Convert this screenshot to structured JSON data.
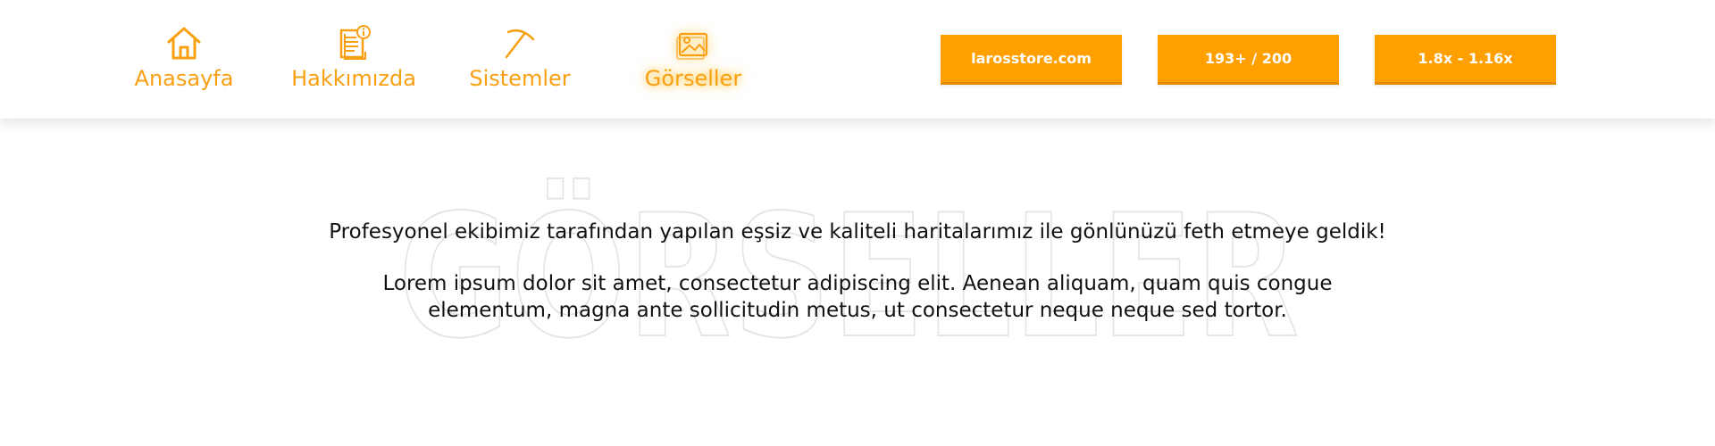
{
  "nav": {
    "items": [
      {
        "label": "Anasayfa",
        "icon": "home-icon"
      },
      {
        "label": "Hakkımızda",
        "icon": "document-info-icon"
      },
      {
        "label": "Sistemler",
        "icon": "pickaxe-icon"
      },
      {
        "label": "Görseller",
        "icon": "image-gallery-icon",
        "active": true
      }
    ]
  },
  "header_buttons": {
    "store": "larosstore.com",
    "players": "193+ / 200",
    "version": "1.8x - 1.16x"
  },
  "page": {
    "bg_title": "GÖRSELLER",
    "intro": "Profesyonel ekibimiz tarafından yapılan eşsiz ve kaliteli haritalarımız ile gönlünüzü feth etmeye geldik!",
    "lorem": "Lorem ipsum dolor sit amet, consectetur adipiscing elit. Aenean aliquam, quam quis congue elementum, magna ante sollicitudin metus, ut consectetur neque neque sed tortor."
  },
  "colors": {
    "accent": "#ff9f00",
    "nav_text": "#f9a012",
    "text": "#111111",
    "outline": "#e4e4e4"
  }
}
